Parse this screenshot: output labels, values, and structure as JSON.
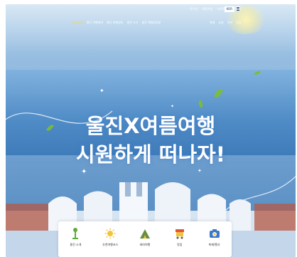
{
  "utility": {
    "links": [
      "로그인",
      "회원가입",
      "사이트맵"
    ],
    "lang_label": "KOR"
  },
  "nav": {
    "items": [
      "울진소개",
      "울진 여행테마",
      "울진 여행정보",
      "울진 소식",
      "울진 체험&관광"
    ],
    "right_items": [
      "축제",
      "쇼핑",
      "숙박",
      "맛집"
    ]
  },
  "hero": {
    "line1": "울진X여름여행",
    "line2": "시원하게 떠나자!"
  },
  "quick_menu": [
    {
      "label": "울진 소개",
      "icon": "tower-icon",
      "color": "#5bab3a"
    },
    {
      "label": "추천여행코스",
      "icon": "sun-icon",
      "color": "#f2c43a"
    },
    {
      "label": "테마여행",
      "icon": "tent-icon",
      "color": "#6a8f3c"
    },
    {
      "label": "맛집",
      "icon": "food-cart-icon",
      "color": "#e0553a"
    },
    {
      "label": "축제/행사",
      "icon": "camera-icon",
      "color": "#3a78c8"
    }
  ],
  "colors": {
    "nav_active": "#ffd23f",
    "sky_top": "#a9cbe8",
    "sea": "#3a78b8"
  }
}
